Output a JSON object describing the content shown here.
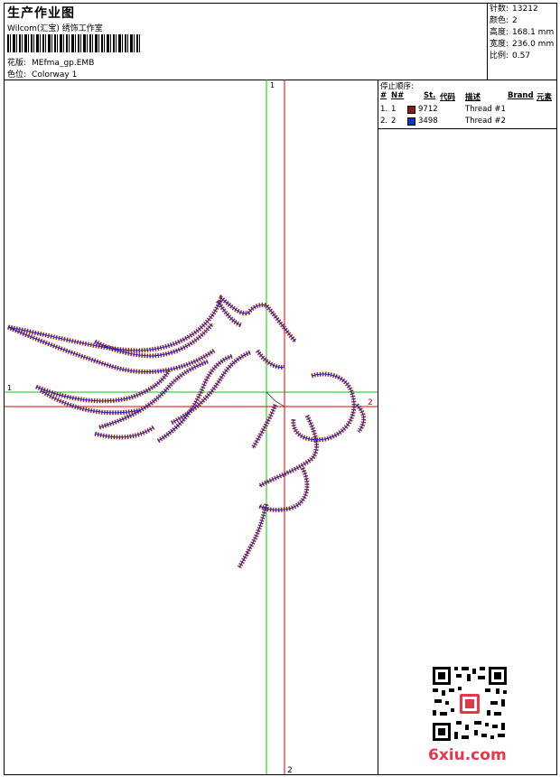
{
  "header": {
    "title": "生产作业图",
    "studio": "Wilcom(汇宝) 绣饰工作室",
    "design_label": "花版:",
    "design_value": "MEfma_gp.EMB",
    "colorway_label": "色位:",
    "colorway_value": "Colorway 1"
  },
  "stats": [
    {
      "label": "针数:",
      "value": "13212"
    },
    {
      "label": "颜色:",
      "value": "2"
    },
    {
      "label": "高度:",
      "value": "168.1 mm"
    },
    {
      "label": "宽度:",
      "value": "236.0 mm"
    },
    {
      "label": "比例:",
      "value": "0.57"
    }
  ],
  "stop_sequence": {
    "title": "停止顺序:",
    "headers": {
      "hash": "#",
      "n": "N#",
      "st": "St.",
      "code": "代码",
      "desc": "描述",
      "brand": "Brand",
      "element": "元素"
    },
    "rows": [
      {
        "num": "1.",
        "n": "1",
        "code": "9712",
        "desc": "Thread #1",
        "color": "#8b1a1a"
      },
      {
        "num": "2.",
        "n": "2",
        "code": "3498",
        "desc": "Thread #2",
        "color": "#1030e0"
      }
    ]
  },
  "crosshair_labels": {
    "green_v": "1",
    "green_h": "1",
    "red_h": "2",
    "red_v": "2"
  },
  "colors": {
    "green": "#00cc00",
    "red": "#e00000",
    "stitch_red": "#9a2a1a",
    "stitch_blue": "#1a1ae0"
  },
  "watermark": {
    "text": "6xiu.com",
    "color": "#e8374a"
  }
}
